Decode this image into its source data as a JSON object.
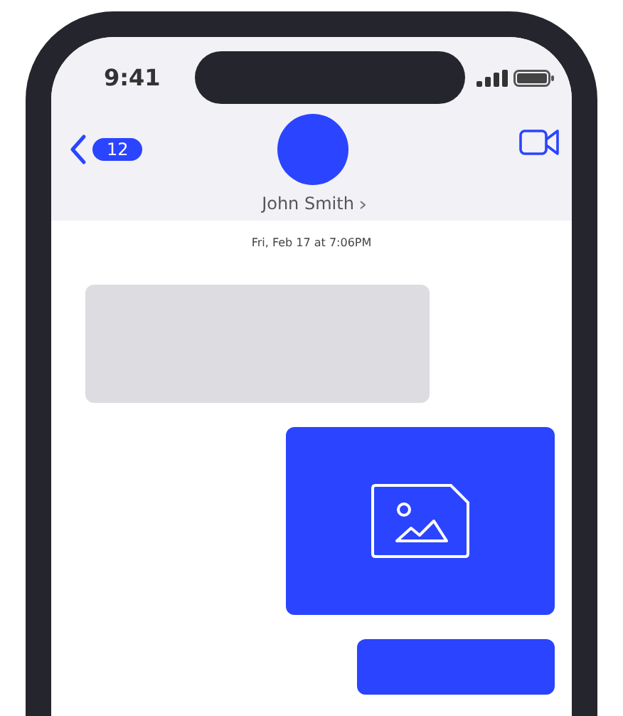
{
  "status_bar": {
    "time": "9:41"
  },
  "header": {
    "unread_count": "12",
    "contact_name": "John Smith"
  },
  "timestamp": "Fri, Feb 17 at 7:06PM",
  "messages": [
    {
      "kind": "incoming"
    },
    {
      "kind": "outgoing_image"
    },
    {
      "kind": "outgoing"
    }
  ]
}
